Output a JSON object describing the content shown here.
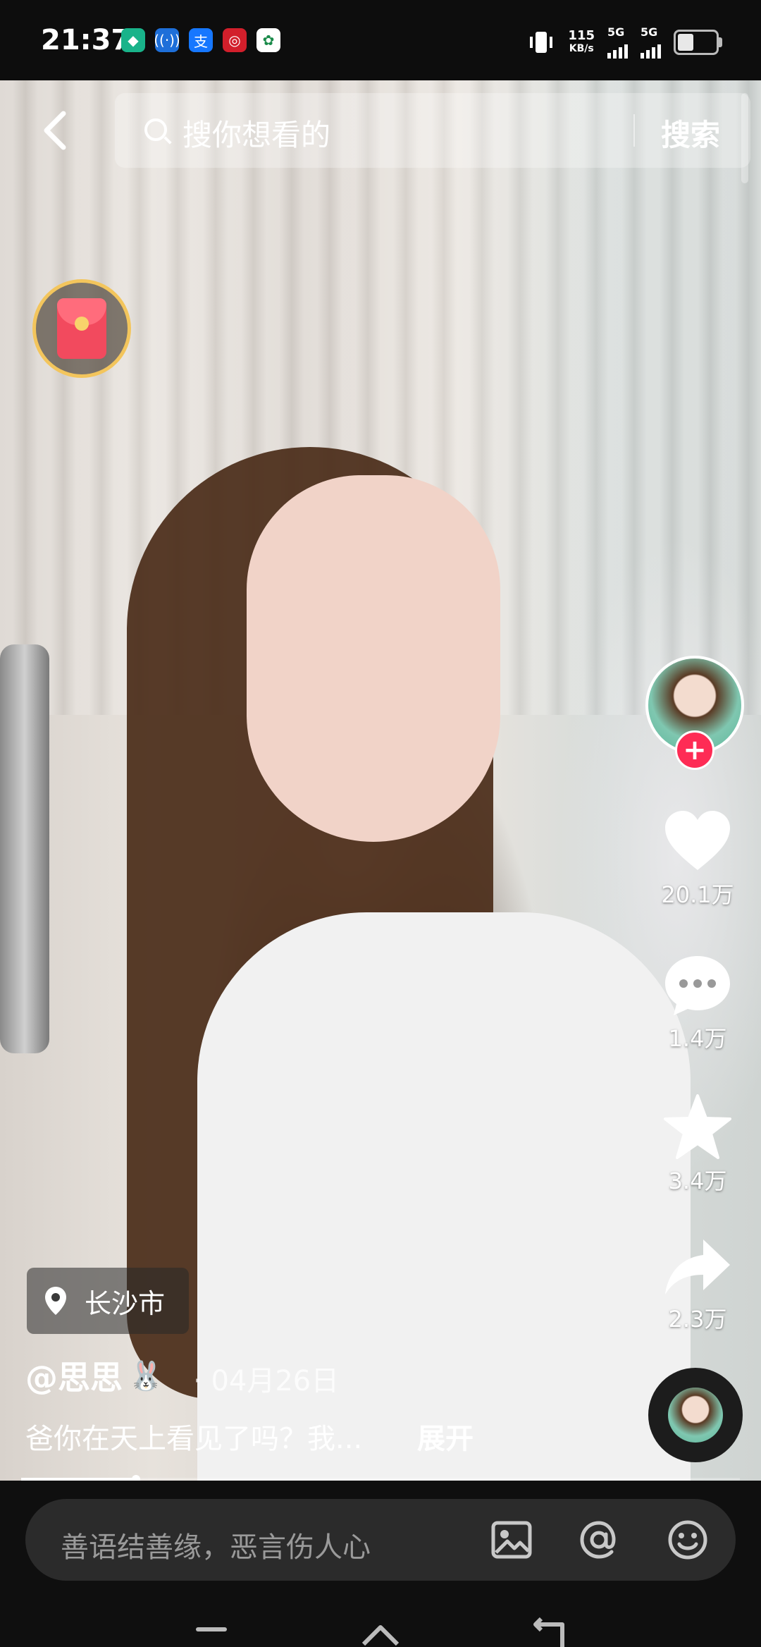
{
  "status_bar": {
    "time": "21:37",
    "app_icons": [
      {
        "name": "shield-app-icon",
        "glyph": "◆",
        "color": "#19b38a"
      },
      {
        "name": "wifi-app-icon",
        "glyph": "((·))",
        "color": "#1e6fd9"
      },
      {
        "name": "alipay-app-icon",
        "glyph": "支",
        "color": "#1677ff"
      },
      {
        "name": "bank-app-icon",
        "glyph": "◎",
        "color": "#d21f2b"
      },
      {
        "name": "green-app-icon",
        "glyph": "✿",
        "color": "#ffffff"
      }
    ],
    "net_speed_value": "115",
    "net_speed_unit": "KB/s",
    "sim1_label": "5G",
    "sim2_label": "5G"
  },
  "search": {
    "placeholder": "搜你想看的",
    "button_label": "搜索"
  },
  "actions": {
    "likes": "20.1万",
    "comments": "1.4万",
    "favorites": "3.4万",
    "shares": "2.3万"
  },
  "video": {
    "location": "长沙市",
    "author": "@思思",
    "author_emoji": "🐰",
    "date_sep": "·",
    "date": "04月26日",
    "description": "爸你在天上看见了吗？我...",
    "expand_label": "展开",
    "progress": 0.16
  },
  "comment": {
    "placeholder": "善语结善缘，恶言伤人心"
  },
  "colors": {
    "accent_red": "#fe2c55",
    "gold": "#f3c55c"
  }
}
